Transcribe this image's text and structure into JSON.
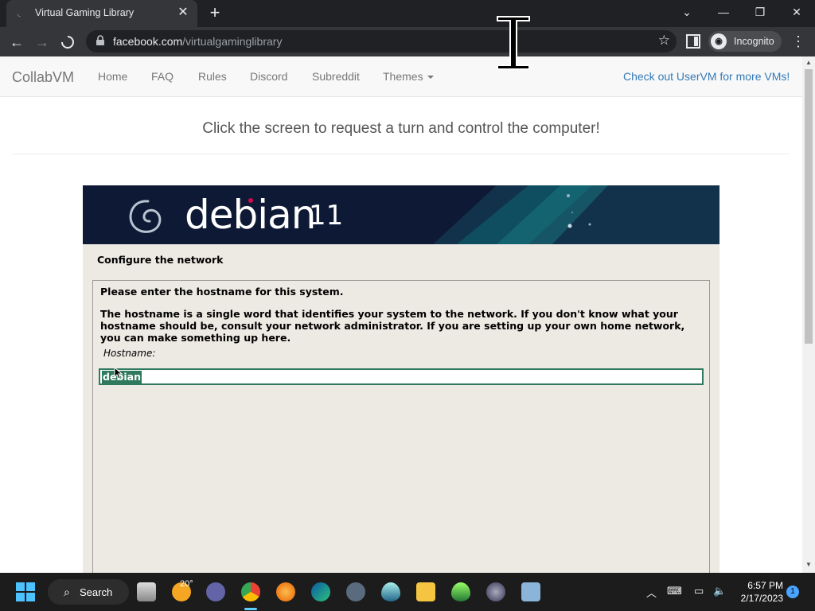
{
  "browser": {
    "tab_title": "Virtual Gaming Library",
    "url_host": "facebook.com",
    "url_path": "/virtualgaminglibrary",
    "incognito_label": "Incognito"
  },
  "nav": {
    "brand": "CollabVM",
    "links": [
      "Home",
      "FAQ",
      "Rules",
      "Discord",
      "Subreddit"
    ],
    "themes_label": "Themes",
    "uservm_link": "Check out UserVM for more VMs!"
  },
  "turn_prompt": "Click the screen to request a turn and control the computer!",
  "vm": {
    "logo_text": "debian",
    "version": "11",
    "section_title": "Configure the network",
    "question": "Please enter the hostname for this system.",
    "description": "The hostname is a single word that identifies your system to the network. If you don't know what your hostname should be, consult your network administrator. If you are setting up your own home network, you can make something up here.",
    "hostname_label": "Hostname:",
    "hostname_value": "debian"
  },
  "taskbar": {
    "search_label": "Search",
    "weather_temp": "20°",
    "time": "6:57 PM",
    "date": "2/17/2023",
    "notification_count": "1",
    "colors": {
      "accent": "#60cdff",
      "background": "#1c1c1c"
    }
  },
  "colors": {
    "debian_banner": "#0e1a35",
    "installer_bg": "#ede9e3",
    "field_border": "#2f7a5f",
    "link": "#337ab7"
  }
}
